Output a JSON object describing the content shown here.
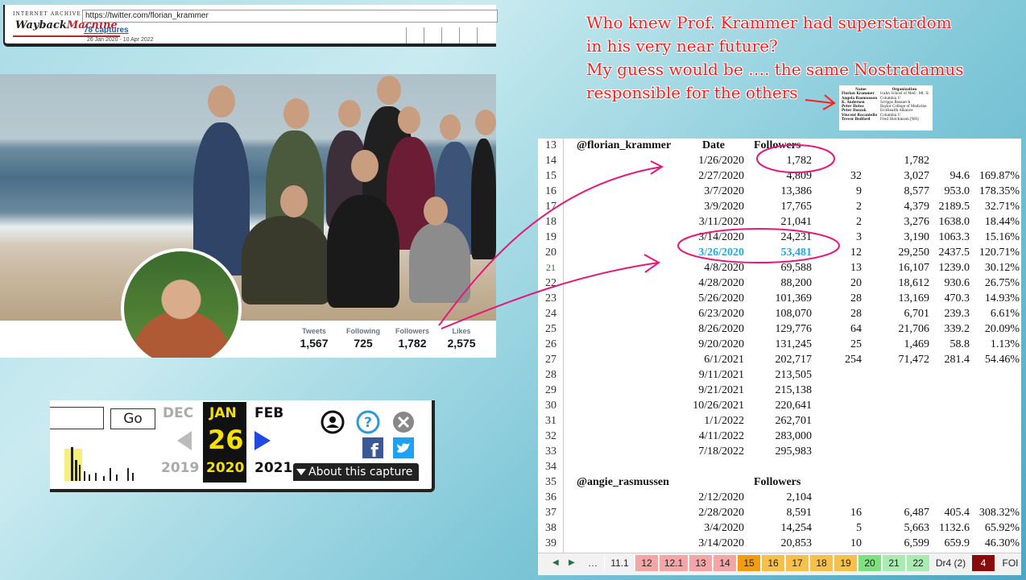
{
  "wayback": {
    "logo_top": "INTERNET ARCHIVE",
    "logo_a": "Wayback",
    "logo_b": "Machine",
    "url": "https://twitter.com/florian_krammer",
    "captures": "78 captures",
    "range": "26 Jan 2020 - 10 Apr 2022"
  },
  "twitter": {
    "stats": [
      {
        "label": "Tweets",
        "value": "1,567"
      },
      {
        "label": "Following",
        "value": "725"
      },
      {
        "label": "Followers",
        "value": "1,782"
      },
      {
        "label": "Likes",
        "value": "2,575"
      }
    ]
  },
  "calendar": {
    "go": "Go",
    "prev_month": "DEC",
    "cur_month": "JAN",
    "next_month": "FEB",
    "day": "26",
    "prev_year": "2019",
    "cur_year": "2020",
    "next_year": "2021",
    "about": "About this capture",
    "colors": {
      "highlight": "#f5e000",
      "arrow": "#2249e0",
      "help": "#2d9ad8",
      "facebook": "#3b5998",
      "twitter": "#1da1f2"
    }
  },
  "annotation": {
    "lines": [
      "Who knew Prof. Krammer had superstardom",
      "in his very near future?",
      "My guess would be …. the same Nostradamus",
      "responsible for the others"
    ],
    "color": "#ff1c1c"
  },
  "mini_table": {
    "headers": [
      "Name",
      "Organization"
    ],
    "rows": [
      [
        "Florian Krammer",
        "Icahn School of Med - Mt. Sinai"
      ],
      [
        "Angela Rasmussen",
        "Columbia U"
      ],
      [
        "K. Andersen",
        "Scripps Research"
      ],
      [
        "Peter Hotez",
        "Baylor College of Medicine"
      ],
      [
        "Peter Daszak",
        "EcoHealth Alliance"
      ],
      [
        "Vincent Racaniello",
        "Columbia U"
      ],
      [
        "Trevor Bedford",
        "Fred Hutchinson [WA]"
      ]
    ]
  },
  "sheet": {
    "rows": [
      {
        "n": "13",
        "a": "@florian_krammer",
        "hb": "Date",
        "hc": "Followers"
      },
      {
        "n": "14",
        "b": "1/26/2020",
        "c": "1,782",
        "e": "1,782"
      },
      {
        "n": "15",
        "b": "2/27/2020",
        "c": "4,809",
        "d": "32",
        "e": "3,027",
        "f": "94.6",
        "g": "169.87%"
      },
      {
        "n": "16",
        "b": "3/7/2020",
        "c": "13,386",
        "d": "9",
        "e": "8,577",
        "f": "953.0",
        "g": "178.35%"
      },
      {
        "n": "17",
        "b": "3/9/2020",
        "c": "17,765",
        "d": "2",
        "e": "4,379",
        "f": "2189.5",
        "g": "32.71%"
      },
      {
        "n": "18",
        "b": "3/11/2020",
        "c": "21,041",
        "d": "2",
        "e": "3,276",
        "f": "1638.0",
        "g": "18.44%"
      },
      {
        "n": "19",
        "b": "3/14/2020",
        "c": "24,231",
        "d": "3",
        "e": "3,190",
        "f": "1063.3",
        "g": "15.16%"
      },
      {
        "n": "20",
        "b": "3/26/2020",
        "c": "53,481",
        "d": "12",
        "e": "29,250",
        "f": "2437.5",
        "g": "120.71%",
        "blue": true
      },
      {
        "n": "21",
        "b": "4/8/2020",
        "c": "69,588",
        "d": "13",
        "e": "16,107",
        "f": "1239.0",
        "g": "30.12%",
        "sel": true
      },
      {
        "n": "22",
        "b": "4/28/2020",
        "c": "88,200",
        "d": "20",
        "e": "18,612",
        "f": "930.6",
        "g": "26.75%"
      },
      {
        "n": "23",
        "b": "5/26/2020",
        "c": "101,369",
        "d": "28",
        "e": "13,169",
        "f": "470.3",
        "g": "14.93%"
      },
      {
        "n": "24",
        "b": "6/23/2020",
        "c": "108,070",
        "d": "28",
        "e": "6,701",
        "f": "239.3",
        "g": "6.61%"
      },
      {
        "n": "25",
        "b": "8/26/2020",
        "c": "129,776",
        "d": "64",
        "e": "21,706",
        "f": "339.2",
        "g": "20.09%"
      },
      {
        "n": "26",
        "b": "9/20/2020",
        "c": "131,245",
        "d": "25",
        "e": "1,469",
        "f": "58.8",
        "g": "1.13%"
      },
      {
        "n": "27",
        "b": "6/1/2021",
        "c": "202,717",
        "d": "254",
        "e": "71,472",
        "f": "281.4",
        "g": "54.46%"
      },
      {
        "n": "28",
        "b": "9/11/2021",
        "c": "213,505"
      },
      {
        "n": "29",
        "b": "9/21/2021",
        "c": "215,138"
      },
      {
        "n": "30",
        "b": "10/26/2021",
        "c": "220,641"
      },
      {
        "n": "31",
        "b": "1/1/2022",
        "c": "262,701"
      },
      {
        "n": "32",
        "b": "4/11/2022",
        "c": "283,000"
      },
      {
        "n": "33",
        "b": "7/18/2022",
        "c": "295,983"
      },
      {
        "n": "34"
      },
      {
        "n": "35",
        "a": "@angie_rasmussen",
        "hc": "Followers"
      },
      {
        "n": "36",
        "b": "2/12/2020",
        "c": "2,104"
      },
      {
        "n": "37",
        "b": "2/28/2020",
        "c": "8,591",
        "d": "16",
        "e": "6,487",
        "f": "405.4",
        "g": "308.32%"
      },
      {
        "n": "38",
        "b": "3/4/2020",
        "c": "14,254",
        "d": "5",
        "e": "5,663",
        "f": "1132.6",
        "g": "65.92%"
      },
      {
        "n": "39",
        "b": "3/14/2020",
        "c": "20,853",
        "d": "10",
        "e": "6,599",
        "f": "659.9",
        "g": "46.30%"
      }
    ],
    "tabs": [
      {
        "label": "…",
        "color": "#f2f2f2"
      },
      {
        "label": "11.1",
        "color": "#f2f2f2"
      },
      {
        "label": "12",
        "color": "#f4a6a6"
      },
      {
        "label": "12.1",
        "color": "#f4a6a6"
      },
      {
        "label": "13",
        "color": "#f4a6a6"
      },
      {
        "label": "14",
        "color": "#f4a6a6"
      },
      {
        "label": "15",
        "color": "#f39c12"
      },
      {
        "label": "16",
        "color": "#f7c04a"
      },
      {
        "label": "17",
        "color": "#f7c04a"
      },
      {
        "label": "18",
        "color": "#f7c04a"
      },
      {
        "label": "19",
        "color": "#f7c04a"
      },
      {
        "label": "20",
        "color": "#7ee07e"
      },
      {
        "label": "21",
        "color": "#a9ecb2"
      },
      {
        "label": "22",
        "color": "#a9ecb2"
      },
      {
        "label": "Dr4 (2)",
        "color": "#f2f2f2"
      },
      {
        "label": "4",
        "color": "#8b0a0a"
      },
      {
        "label": "FOI",
        "color": "#f2f2f2"
      }
    ]
  }
}
